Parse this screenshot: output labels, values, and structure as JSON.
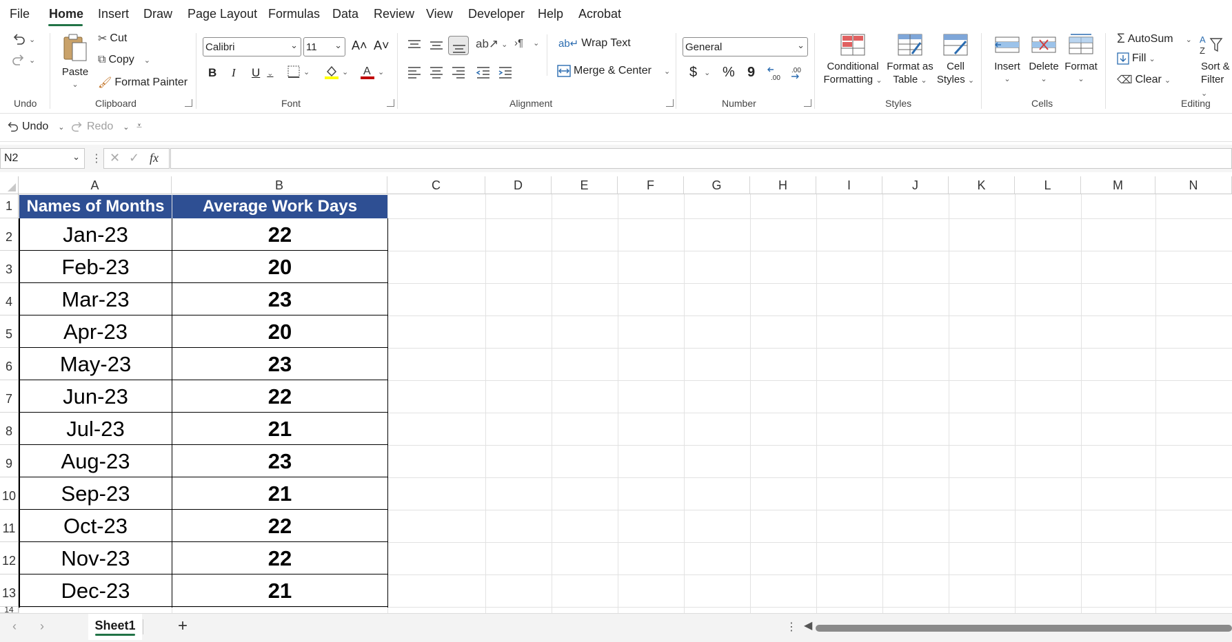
{
  "menu": {
    "tabs": [
      "File",
      "Home",
      "Insert",
      "Draw",
      "Page Layout",
      "Formulas",
      "Data",
      "Review",
      "View",
      "Developer",
      "Help",
      "Acrobat"
    ]
  },
  "ribbon": {
    "undo_group": "Undo",
    "clipboard": {
      "label": "Clipboard",
      "paste": "Paste",
      "cut": "Cut",
      "copy": "Copy",
      "format_painter": "Format Painter"
    },
    "font": {
      "label": "Font",
      "family": "Calibri",
      "size": "11",
      "bold": "B",
      "italic": "I",
      "underline": "U",
      "grow": "A˄",
      "shrink": "A˅"
    },
    "alignment": {
      "label": "Alignment",
      "wrap_text": "Wrap Text",
      "merge_center": "Merge & Center"
    },
    "number": {
      "label": "Number",
      "format": "General",
      "currency": "$",
      "percent": "%",
      "comma": "9"
    },
    "styles": {
      "label": "Styles",
      "conditional_1": "Conditional",
      "conditional_2": "Formatting",
      "format_table_1": "Format as",
      "format_table_2": "Table",
      "cell_styles_1": "Cell",
      "cell_styles_2": "Styles"
    },
    "cells": {
      "label": "Cells",
      "insert": "Insert",
      "delete": "Delete",
      "format": "Format"
    },
    "editing": {
      "label": "Editing",
      "autosum": "AutoSum",
      "fill": "Fill",
      "clear": "Clear",
      "sort_1": "Sort &",
      "sort_2": "Filter"
    }
  },
  "qat": {
    "undo": "Undo",
    "redo": "Redo"
  },
  "formula_bar": {
    "name_box": "N2",
    "fx": "fx",
    "formula": ""
  },
  "grid": {
    "columns": [
      "A",
      "B",
      "C",
      "D",
      "E",
      "F",
      "G",
      "H",
      "I",
      "J",
      "K",
      "L",
      "M",
      "N"
    ],
    "rows": [
      "1",
      "2",
      "3",
      "4",
      "5",
      "6",
      "7",
      "8",
      "9",
      "10",
      "11",
      "12",
      "13",
      "14"
    ]
  },
  "table": {
    "headers": [
      "Names of Months",
      "Average Work Days"
    ],
    "rows": [
      {
        "month": "Jan-23",
        "days": "22"
      },
      {
        "month": "Feb-23",
        "days": "20"
      },
      {
        "month": "Mar-23",
        "days": "23"
      },
      {
        "month": "Apr-23",
        "days": "20"
      },
      {
        "month": "May-23",
        "days": "23"
      },
      {
        "month": "Jun-23",
        "days": "22"
      },
      {
        "month": "Jul-23",
        "days": "21"
      },
      {
        "month": "Aug-23",
        "days": "23"
      },
      {
        "month": "Sep-23",
        "days": "21"
      },
      {
        "month": "Oct-23",
        "days": "22"
      },
      {
        "month": "Nov-23",
        "days": "22"
      },
      {
        "month": "Dec-23",
        "days": "21"
      }
    ]
  },
  "sheets": {
    "active": "Sheet1",
    "add": "+"
  },
  "colors": {
    "header_fill": "#2e4f93",
    "accent": "#217346"
  }
}
